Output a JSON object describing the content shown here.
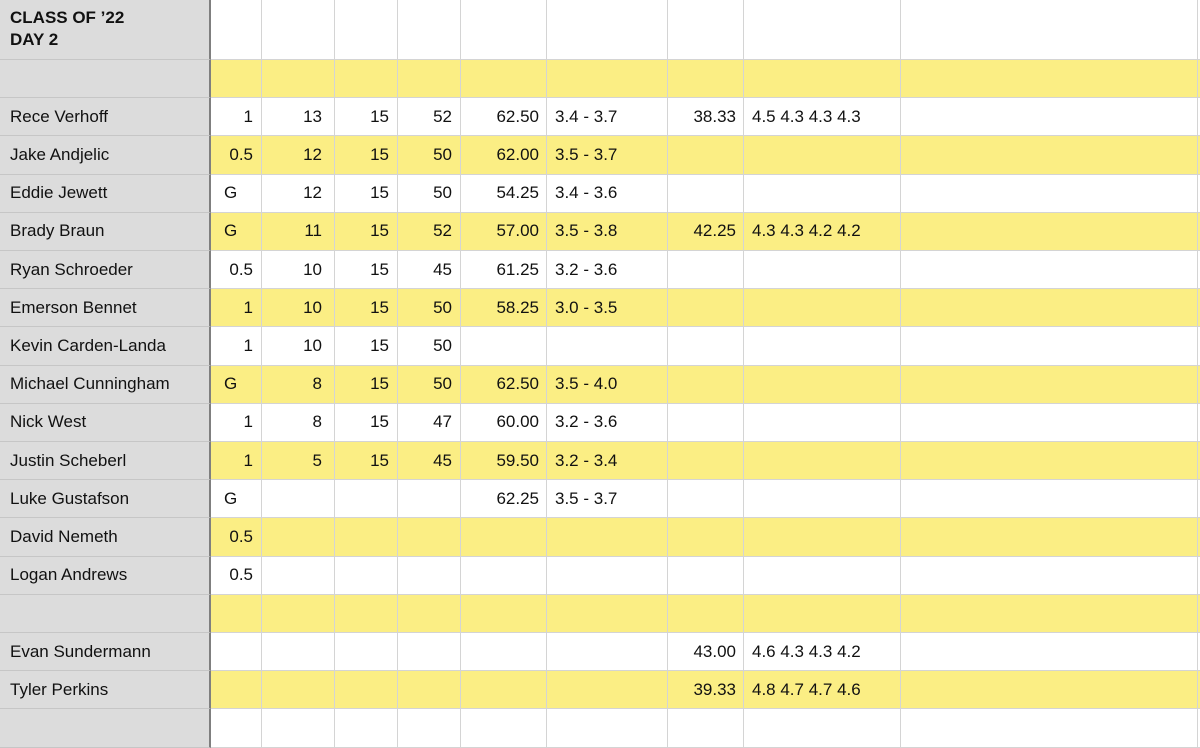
{
  "sheet": {
    "title": "CLASS OF ’22\nDAY 2",
    "colors": {
      "highlight": "#fbee84",
      "name_column": "#dcdcdc",
      "grid": "#d4d4d4"
    },
    "rows": [
      {
        "name": "",
        "values": [
          "",
          "",
          "",
          "",
          "",
          "",
          "",
          "",
          "",
          ""
        ],
        "highlight": true
      },
      {
        "name": "Rece Verhoff",
        "values": [
          "1",
          "13",
          "15",
          "52",
          "62.50",
          "3.4 - 3.7",
          "38.33",
          "4.5 4.3 4.3 4.3",
          "",
          ""
        ],
        "highlight": false
      },
      {
        "name": "Jake Andjelic",
        "values": [
          "0.5",
          "12",
          "15",
          "50",
          "62.00",
          "3.5 - 3.7",
          "",
          "",
          "",
          ""
        ],
        "highlight": true
      },
      {
        "name": "Eddie Jewett",
        "values": [
          "G",
          "12",
          "15",
          "50",
          "54.25",
          "3.4 - 3.6",
          "",
          "",
          "",
          ""
        ],
        "highlight": false
      },
      {
        "name": "Brady Braun",
        "values": [
          "G",
          "11",
          "15",
          "52",
          "57.00",
          "3.5 - 3.8",
          "42.25",
          "4.3 4.3 4.2 4.2",
          "",
          ""
        ],
        "highlight": true
      },
      {
        "name": "Ryan Schroeder",
        "values": [
          "0.5",
          "10",
          "15",
          "45",
          "61.25",
          "3.2 - 3.6",
          "",
          "",
          "",
          ""
        ],
        "highlight": false
      },
      {
        "name": "Emerson Bennet",
        "values": [
          "1",
          "10",
          "15",
          "50",
          "58.25",
          "3.0 - 3.5",
          "",
          "",
          "",
          ""
        ],
        "highlight": true
      },
      {
        "name": "Kevin Carden-Landa",
        "values": [
          "1",
          "10",
          "15",
          "50",
          "",
          "",
          "",
          "",
          "",
          ""
        ],
        "highlight": false
      },
      {
        "name": "Michael Cunningham",
        "values": [
          "G",
          "8",
          "15",
          "50",
          "62.50",
          "3.5 - 4.0",
          "",
          "",
          "",
          ""
        ],
        "highlight": true
      },
      {
        "name": "Nick West",
        "values": [
          "1",
          "8",
          "15",
          "47",
          "60.00",
          "3.2 - 3.6",
          "",
          "",
          "",
          ""
        ],
        "highlight": false
      },
      {
        "name": "Justin Scheberl",
        "values": [
          "1",
          "5",
          "15",
          "45",
          "59.50",
          "3.2 - 3.4",
          "",
          "",
          "",
          ""
        ],
        "highlight": true
      },
      {
        "name": "Luke Gustafson",
        "values": [
          "G",
          "",
          "",
          "",
          "62.25",
          "3.5 - 3.7",
          "",
          "",
          "",
          ""
        ],
        "highlight": false
      },
      {
        "name": "David Nemeth",
        "values": [
          "0.5",
          "",
          "",
          "",
          "",
          "",
          "",
          "",
          "",
          ""
        ],
        "highlight": true
      },
      {
        "name": "Logan Andrews",
        "values": [
          "0.5",
          "",
          "",
          "",
          "",
          "",
          "",
          "",
          "",
          ""
        ],
        "highlight": false
      },
      {
        "name": "",
        "values": [
          "",
          "",
          "",
          "",
          "",
          "",
          "",
          "",
          "",
          ""
        ],
        "highlight": true
      },
      {
        "name": "Evan Sundermann",
        "values": [
          "",
          "",
          "",
          "",
          "",
          "",
          "43.00",
          "4.6 4.3 4.3 4.2",
          "",
          ""
        ],
        "highlight": false
      },
      {
        "name": "Tyler Perkins",
        "values": [
          "",
          "",
          "",
          "",
          "",
          "",
          "39.33",
          "4.8 4.7 4.7 4.6",
          "",
          ""
        ],
        "highlight": true
      },
      {
        "name": "",
        "values": [
          "",
          "",
          "",
          "",
          "",
          "",
          "",
          "",
          "",
          ""
        ],
        "highlight": false
      }
    ]
  }
}
